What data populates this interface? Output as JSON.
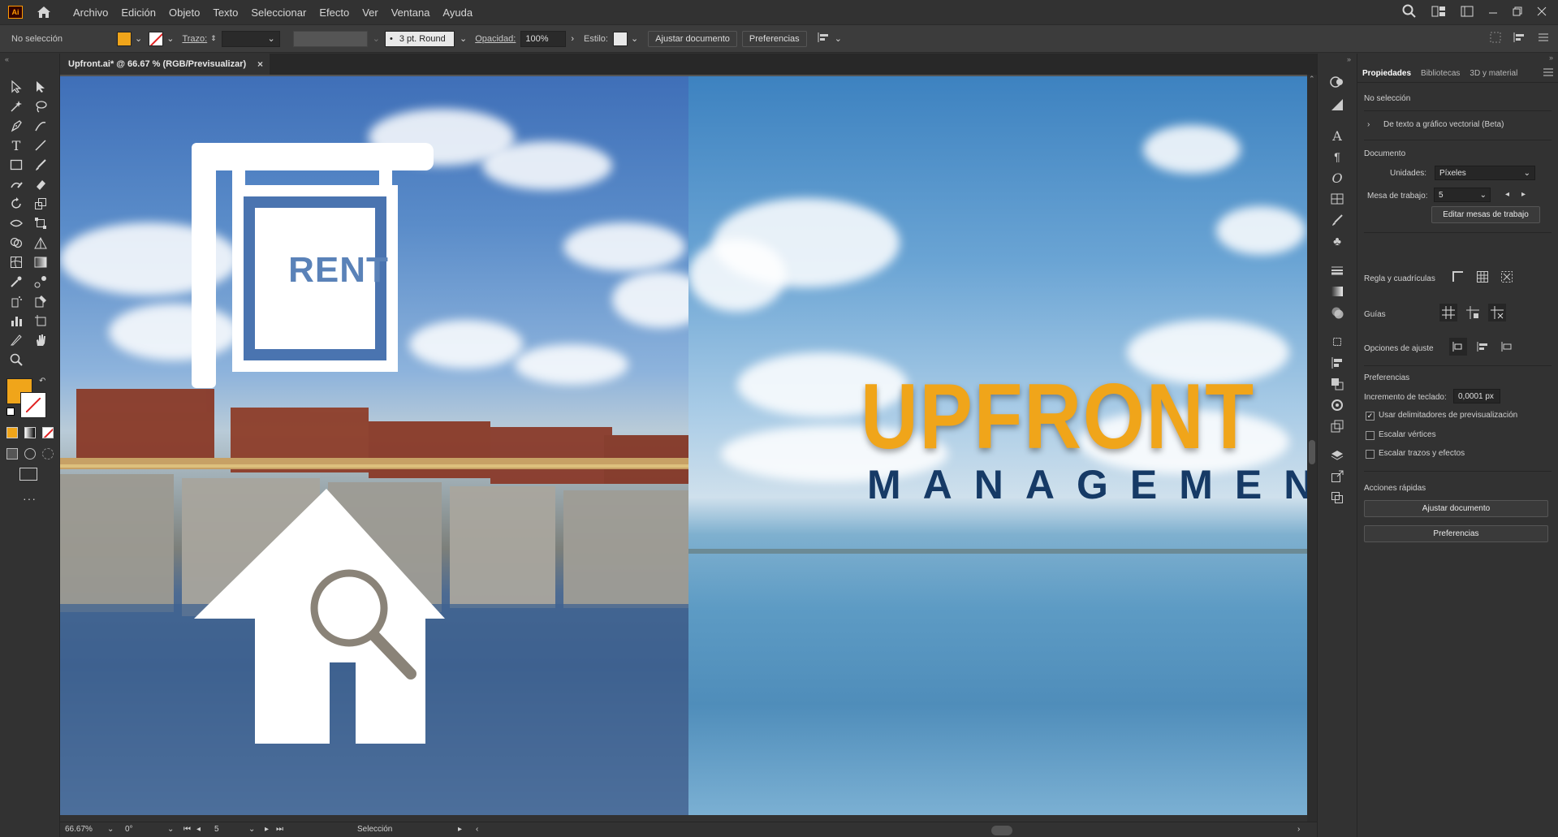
{
  "app": {
    "logo": "Ai"
  },
  "menu": [
    "Archivo",
    "Edición",
    "Objeto",
    "Texto",
    "Seleccionar",
    "Efecto",
    "Ver",
    "Ventana",
    "Ayuda"
  ],
  "control": {
    "selection": "No selección",
    "stroke_label": "Trazo:",
    "brush": "3 pt. Round",
    "opacity_label": "Opacidad:",
    "opacity_value": "100%",
    "style_label": "Estilo:",
    "fit_doc": "Ajustar documento",
    "prefs": "Preferencias"
  },
  "document": {
    "tab": "Upfront.ai* @ 66.67 % (RGB/Previsualizar)",
    "close": "×"
  },
  "artwork": {
    "rent_text": "RENT",
    "brand_title": "UPFRONT",
    "brand_sub": "MANAGEMENT"
  },
  "panel": {
    "tabs": [
      "Propiedades",
      "Bibliotecas",
      "3D y material"
    ],
    "no_selection": "No selección",
    "text_to_vector": "De texto a gráfico vectorial (Beta)",
    "document_label": "Documento",
    "units_label": "Unidades:",
    "units_value": "Píxeles",
    "artboard_label": "Mesa de trabajo:",
    "artboard_value": "5",
    "edit_artboards": "Editar mesas de trabajo",
    "rulers_label": "Regla y cuadrículas",
    "guides_label": "Guías",
    "snap_label": "Opciones de ajuste",
    "prefs_label": "Preferencias",
    "keyboard_label": "Incremento de teclado:",
    "keyboard_value": "0,0001 px",
    "cb_preview": "Usar delimitadores de previsualización",
    "cb_corners": "Escalar vértices",
    "cb_strokes": "Escalar trazos y efectos",
    "quick_label": "Acciones rápidas",
    "quick_fit": "Ajustar documento",
    "quick_prefs": "Preferencias"
  },
  "status": {
    "zoom": "66.67%",
    "rotation": "0°",
    "artboard": "5",
    "tool": "Selección"
  },
  "colors": {
    "fill": "#f0a51a",
    "brand_orange": "#f0a51a",
    "brand_navy": "#163a66",
    "accent": "#ff9a00"
  }
}
